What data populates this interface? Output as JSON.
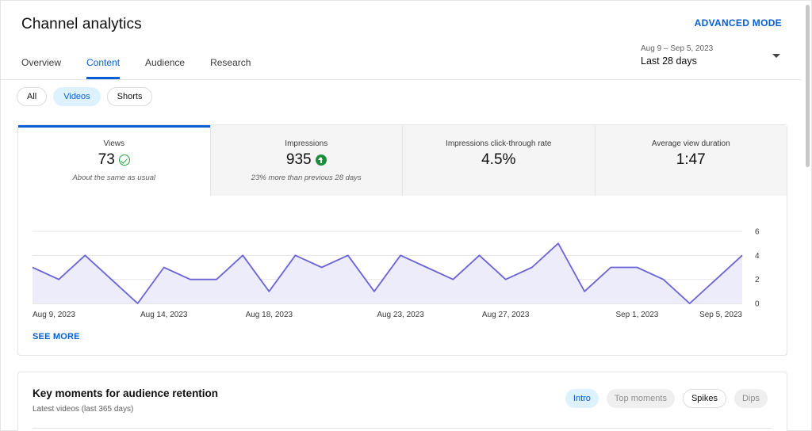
{
  "header": {
    "title": "Channel analytics",
    "advanced_mode": "ADVANCED MODE"
  },
  "tabs": [
    {
      "label": "Overview",
      "active": false
    },
    {
      "label": "Content",
      "active": true
    },
    {
      "label": "Audience",
      "active": false
    },
    {
      "label": "Research",
      "active": false
    }
  ],
  "date_range": {
    "dates": "Aug 9 – Sep 5, 2023",
    "period": "Last 28 days"
  },
  "filters": [
    {
      "label": "All",
      "selected": false
    },
    {
      "label": "Videos",
      "selected": true
    },
    {
      "label": "Shorts",
      "selected": false
    }
  ],
  "metrics": [
    {
      "label": "Views",
      "value": "73",
      "icon": "check-circle-icon",
      "note": "About the same as usual"
    },
    {
      "label": "Impressions",
      "value": "935",
      "icon": "arrow-up-circle-icon",
      "note": "23% more than previous 28 days"
    },
    {
      "label": "Impressions click-through rate",
      "value": "4.5%",
      "icon": "",
      "note": ""
    },
    {
      "label": "Average view duration",
      "value": "1:47",
      "icon": "",
      "note": ""
    }
  ],
  "see_more": "SEE MORE",
  "key_moments": {
    "title": "Key moments for audience retention",
    "subtitle": "Latest videos (last 365 days)",
    "chips": [
      {
        "label": "Intro",
        "state": "selected"
      },
      {
        "label": "Top moments",
        "state": "disabled"
      },
      {
        "label": "Spikes",
        "state": "outlined"
      },
      {
        "label": "Dips",
        "state": "disabled"
      }
    ]
  },
  "colors": {
    "accent": "#065fd4",
    "line": "#6b63d9",
    "area": "#ececfa",
    "positive": "#1e8e3e"
  },
  "chart_data": {
    "type": "area",
    "series": [
      {
        "values": [
          3,
          2,
          4,
          2,
          0,
          3,
          2,
          2,
          4,
          1,
          4,
          3,
          4,
          1,
          4,
          3,
          2,
          4,
          2,
          3,
          5,
          1,
          3,
          3,
          2,
          0,
          2,
          4
        ]
      }
    ],
    "x": [
      "Aug 9",
      "Aug 10",
      "Aug 11",
      "Aug 12",
      "Aug 13",
      "Aug 14",
      "Aug 15",
      "Aug 16",
      "Aug 17",
      "Aug 18",
      "Aug 19",
      "Aug 20",
      "Aug 21",
      "Aug 22",
      "Aug 23",
      "Aug 24",
      "Aug 25",
      "Aug 26",
      "Aug 27",
      "Aug 28",
      "Aug 29",
      "Aug 30",
      "Aug 31",
      "Sep 1",
      "Sep 2",
      "Sep 3",
      "Sep 4",
      "Sep 5"
    ],
    "x_tick_labels": [
      {
        "label": "Aug 9, 2023",
        "x": "Aug 9"
      },
      {
        "label": "Aug 14, 2023",
        "x": "Aug 14"
      },
      {
        "label": "Aug 18, 2023",
        "x": "Aug 18"
      },
      {
        "label": "Aug 23, 2023",
        "x": "Aug 23"
      },
      {
        "label": "Aug 27, 2023",
        "x": "Aug 27"
      },
      {
        "label": "Sep 1, 2023",
        "x": "Sep 1"
      },
      {
        "label": "Sep 5, 2023",
        "x": "Sep 5"
      }
    ],
    "y_ticks": [
      0,
      2,
      4,
      6
    ],
    "ylim": [
      0,
      6
    ],
    "grid": true
  }
}
